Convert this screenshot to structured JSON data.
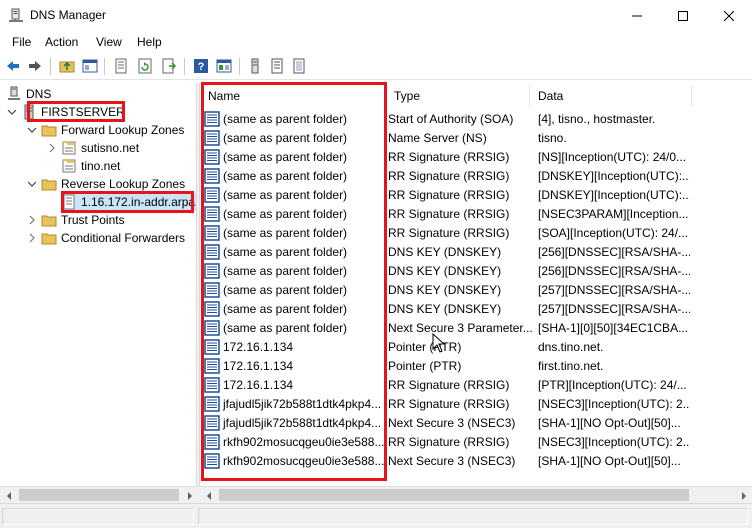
{
  "window": {
    "title": "DNS Manager",
    "icon": "dns-manager-icon",
    "buttons": [
      "minimize-icon",
      "maximize-icon",
      "close-icon"
    ]
  },
  "menu": {
    "items": [
      "File",
      "Action",
      "View",
      "Help"
    ]
  },
  "toolbar": {
    "icons": [
      "back-icon",
      "forward-icon",
      "up-folder-icon",
      "show-hide-tree-icon",
      "properties-icon",
      "refresh-icon",
      "export-list-icon",
      "help-icon",
      "mmc-icon",
      "new-host-icon",
      "new-alias-icon",
      "new-mail-exchanger-icon"
    ]
  },
  "tree": {
    "root": "DNS",
    "server": "FIRSTSERVER",
    "forward_zones": "Forward Lookup Zones",
    "forward_children": [
      "sutisno.net",
      "tino.net"
    ],
    "reverse_zones": "Reverse Lookup Zones",
    "reverse_children": [
      "1.16.172.in-addr.arpa"
    ],
    "trust_points": "Trust Points",
    "conditional_forwarders": "Conditional Forwarders"
  },
  "list": {
    "columns": [
      "Name",
      "Type",
      "Data"
    ],
    "rows": [
      {
        "name": "(same as parent folder)",
        "type": "Start of Authority (SOA)",
        "data": "[4], tisno., hostmaster."
      },
      {
        "name": "(same as parent folder)",
        "type": "Name Server (NS)",
        "data": "tisno."
      },
      {
        "name": "(same as parent folder)",
        "type": "RR Signature (RRSIG)",
        "data": "[NS][Inception(UTC): 24/0..."
      },
      {
        "name": "(same as parent folder)",
        "type": "RR Signature (RRSIG)",
        "data": "[DNSKEY][Inception(UTC):..."
      },
      {
        "name": "(same as parent folder)",
        "type": "RR Signature (RRSIG)",
        "data": "[DNSKEY][Inception(UTC):..."
      },
      {
        "name": "(same as parent folder)",
        "type": "RR Signature (RRSIG)",
        "data": "[NSEC3PARAM][Inception..."
      },
      {
        "name": "(same as parent folder)",
        "type": "RR Signature (RRSIG)",
        "data": "[SOA][Inception(UTC): 24/..."
      },
      {
        "name": "(same as parent folder)",
        "type": "DNS KEY (DNSKEY)",
        "data": "[256][DNSSEC][RSA/SHA-..."
      },
      {
        "name": "(same as parent folder)",
        "type": "DNS KEY (DNSKEY)",
        "data": "[256][DNSSEC][RSA/SHA-..."
      },
      {
        "name": "(same as parent folder)",
        "type": "DNS KEY (DNSKEY)",
        "data": "[257][DNSSEC][RSA/SHA-..."
      },
      {
        "name": "(same as parent folder)",
        "type": "DNS KEY (DNSKEY)",
        "data": "[257][DNSSEC][RSA/SHA-..."
      },
      {
        "name": "(same as parent folder)",
        "type": "Next Secure 3 Parameter...",
        "data": "[SHA-1][0][50][34EC1CBA..."
      },
      {
        "name": "172.16.1.134",
        "type": "Pointer (PTR)",
        "data": "dns.tino.net."
      },
      {
        "name": "172.16.1.134",
        "type": "Pointer (PTR)",
        "data": "first.tino.net."
      },
      {
        "name": "172.16.1.134",
        "type": "RR Signature (RRSIG)",
        "data": "[PTR][Inception(UTC): 24/..."
      },
      {
        "name": "jfajudl5jik72b588t1dtk4pkp4...",
        "type": "RR Signature (RRSIG)",
        "data": "[NSEC3][Inception(UTC): 2..."
      },
      {
        "name": "jfajudl5jik72b588t1dtk4pkp4...",
        "type": "Next Secure 3 (NSEC3)",
        "data": "[SHA-1][NO Opt-Out][50]..."
      },
      {
        "name": "rkfh902mosucqgeu0ie3e588...",
        "type": "RR Signature (RRSIG)",
        "data": "[NSEC3][Inception(UTC): 2..."
      },
      {
        "name": "rkfh902mosucqgeu0ie3e588...",
        "type": "Next Secure 3 (NSEC3)",
        "data": "[SHA-1][NO Opt-Out][50]..."
      }
    ]
  },
  "colors": {
    "annotation_red": "#e8141b",
    "selection_lavender": "#d9d9f5",
    "record_icon_blue": "#1f4e9c"
  }
}
